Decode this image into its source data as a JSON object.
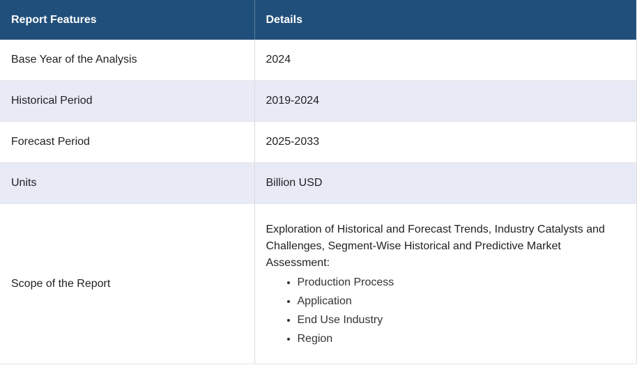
{
  "table": {
    "headers": [
      "Report Features",
      "Details"
    ],
    "rows": [
      {
        "feature": "Base Year of the Analysis",
        "detail": "2024"
      },
      {
        "feature": "Historical Period",
        "detail": "2019-2024"
      },
      {
        "feature": "Forecast Period",
        "detail": "2025-2033"
      },
      {
        "feature": "Units",
        "detail": "Billion USD"
      },
      {
        "feature": "Scope of the Report",
        "detail": "Exploration of Historical and Forecast Trends, Industry Catalysts and Challenges, Segment-Wise Historical and Predictive Market Assessment:",
        "list": [
          "Production Process",
          "Application",
          "End Use Industry",
          "Region"
        ]
      }
    ]
  },
  "colors": {
    "header_bg": "#204f7b",
    "alt_row_bg": "#e8eaf6"
  }
}
